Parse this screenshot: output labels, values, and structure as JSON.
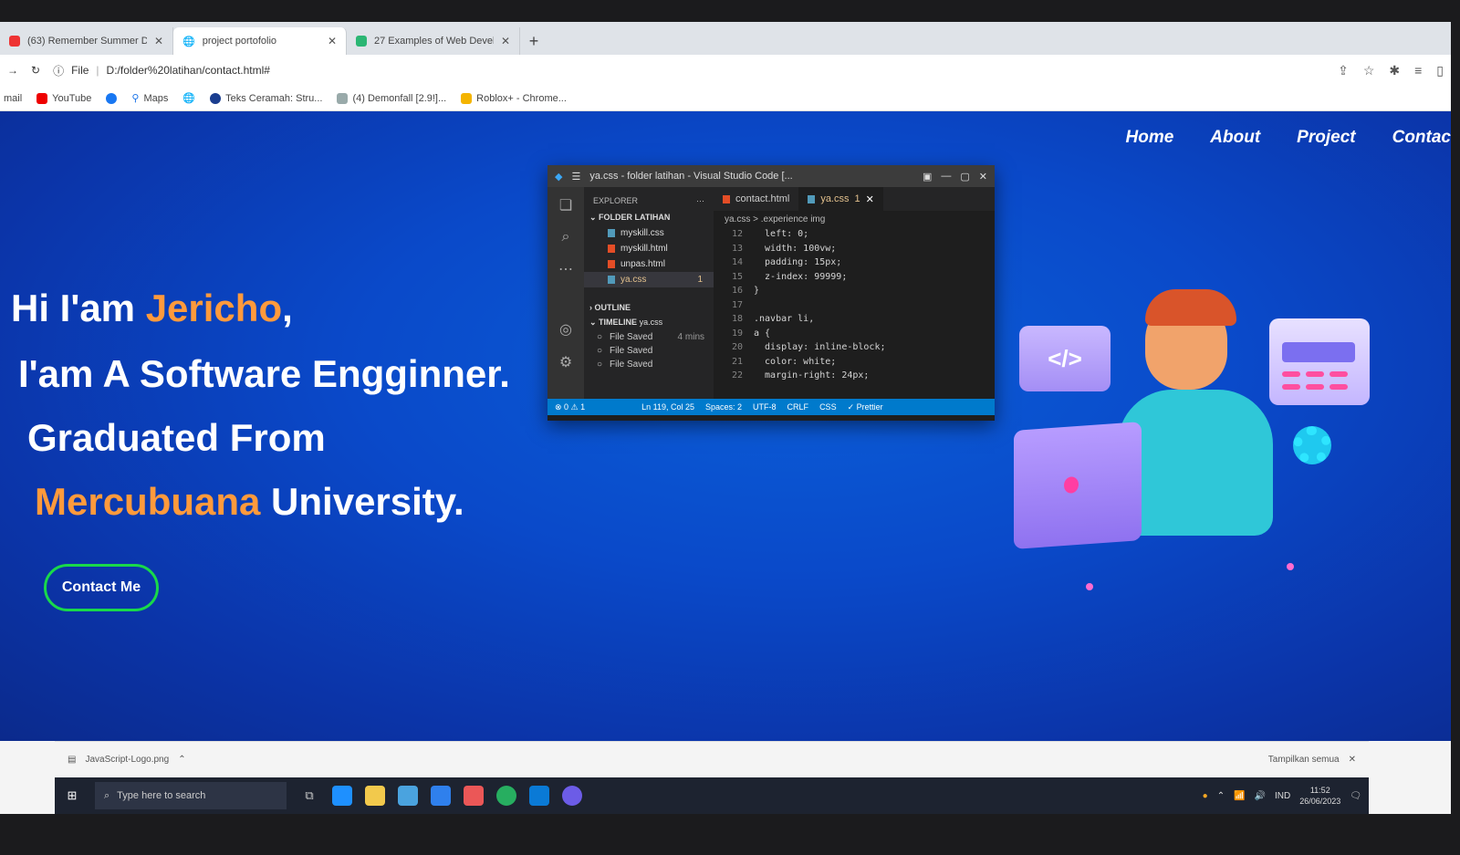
{
  "browser": {
    "tabs": [
      {
        "title": "(63) Remember Summer D..."
      },
      {
        "title": "project portofolio"
      },
      {
        "title": "27 Examples of Web Developer"
      }
    ],
    "address": "D:/folder%20latihan/contact.html#",
    "file_label": "File",
    "bookmarks": [
      "mail",
      "YouTube",
      "Maps",
      "Teks Ceramah: Stru...",
      "(4) Demonfall [2.9!]...",
      "Roblox+ - Chrome..."
    ]
  },
  "nav": {
    "home": "Home",
    "about": "About",
    "project": "Project",
    "contact": "Contac"
  },
  "hero": {
    "l1a": "Hi I'am ",
    "l1b": "Jericho",
    "l1c": ",",
    "l2": "I'am A Software Engginner.",
    "l3": "Graduated From",
    "l4a": "Mercubuana",
    "l4b": " University.",
    "button": "Contact Me"
  },
  "vscode": {
    "title": "ya.css - folder latihan - Visual Studio Code [...",
    "explorer": "EXPLORER",
    "folder": "FOLDER LATIHAN",
    "files": [
      {
        "name": "myskill.css",
        "color": "#519aba"
      },
      {
        "name": "myskill.html",
        "color": "#e44d26"
      },
      {
        "name": "unpas.html",
        "color": "#e44d26"
      },
      {
        "name": "ya.css",
        "color": "#519aba",
        "badge": "1"
      }
    ],
    "outline": "OUTLINE",
    "timeline": "TIMELINE",
    "timeline_file": "ya.css",
    "timeline_items": [
      {
        "label": "File Saved",
        "time": "4 mins"
      },
      {
        "label": "File Saved",
        "time": ""
      },
      {
        "label": "File Saved",
        "time": ""
      }
    ],
    "tabs": [
      {
        "name": "contact.html"
      },
      {
        "name": "ya.css",
        "badge": "1"
      }
    ],
    "breadcrumb": "ya.css > .experience img",
    "line_numbers": [
      "12",
      "13",
      "14",
      "15",
      "16",
      "17",
      "18",
      "19",
      "20",
      "21",
      "22"
    ],
    "code": "  left: 0;\n  width: 100vw;\n  padding: 15px;\n  z-index: 99999;\n}\n\n.navbar li,\na {\n  display: inline-block;\n  color: white;\n  margin-right: 24px;",
    "status": {
      "errors": "⊗ 0 ⚠ 1",
      "pos": "Ln 119, Col 25",
      "spaces": "Spaces: 2",
      "enc": "UTF-8",
      "eol": "CRLF",
      "lang": "CSS",
      "prettier": "✓ Prettier"
    }
  },
  "illus": {
    "code_tag": "</>"
  },
  "download": {
    "file": "JavaScript-Logo.png",
    "show_all": "Tampilkan semua"
  },
  "taskbar": {
    "search": "Type here to search",
    "lang": "IND",
    "time": "11:52",
    "date": "26/06/2023"
  }
}
